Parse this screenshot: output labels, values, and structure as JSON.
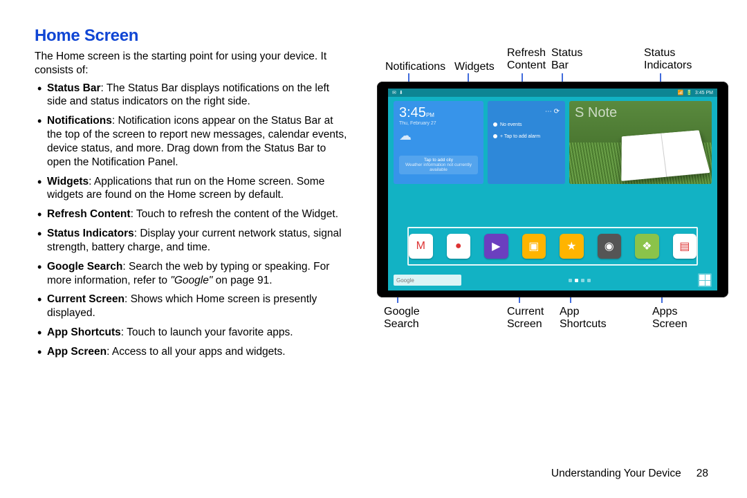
{
  "heading": "Home Screen",
  "intro": "The Home screen is the starting point for using your device. It consists of:",
  "bullets": [
    {
      "term": "Status Bar",
      "text": ": The Status Bar displays notifications on the left side and status indicators on the right side."
    },
    {
      "term": "Notifications",
      "text": ": Notification icons appear on the Status Bar at the top of the screen to report new messages, calendar events, device status, and more. Drag down from the Status Bar to open the Notification Panel."
    },
    {
      "term": "Widgets",
      "text": ": Applications that run on the Home screen. Some widgets are found on the Home screen by default."
    },
    {
      "term": "Refresh Content",
      "text": ": Touch to refresh the content of the Widget."
    },
    {
      "term": "Status Indicators",
      "text": ": Display your current network status, signal strength, battery charge, and time."
    },
    {
      "term": "Google Search",
      "text": ": Search the web by typing or speaking. For more information, refer to ",
      "ref": "\"Google\"",
      "after": " on page 91."
    },
    {
      "term": "Current Screen",
      "text": ": Shows which Home screen is presently displayed."
    },
    {
      "term": "App Shortcuts",
      "text": ": Touch to launch your favorite apps."
    },
    {
      "term": "App Screen",
      "text": ": Access to all your apps and widgets."
    }
  ],
  "callouts_top": {
    "notifications": "Notifications",
    "widgets": "Widgets",
    "refresh": "Refresh\nContent",
    "statusbar": "Status\nBar",
    "indicators": "Status\nIndicators"
  },
  "callouts_bottom": {
    "gsearch": "Google\nSearch",
    "current": "Current\nScreen",
    "shortcuts": "App\nShortcuts",
    "apps": "Apps\nScreen"
  },
  "device": {
    "time": "3:45",
    "ampm": "PM",
    "date": "Thu, February 27",
    "weather_tap": "Tap to add city",
    "weather_sub": "Weather information not currently available",
    "noevents": "No events",
    "addalarm": "+ Tap to add alarm",
    "snote": "S Note",
    "sb_time": "3:45 PM",
    "search_placeholder": "Google"
  },
  "app_colors": [
    "#fff",
    "#fff",
    "#6b3fbf",
    "#ffb400",
    "#ffb400",
    "#555",
    "#8bc34a",
    "#fff"
  ],
  "footer_section": "Understanding Your Device",
  "footer_page": "28"
}
